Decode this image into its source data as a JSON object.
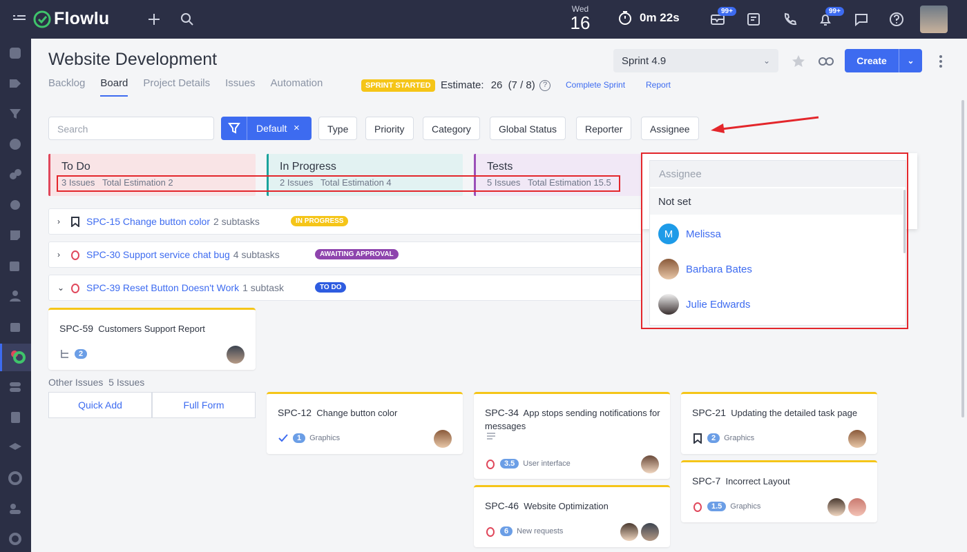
{
  "app": {
    "name": "Flowlu"
  },
  "topbar": {
    "date_weekday": "Wed",
    "date_day": "16",
    "timer": "0m 22s",
    "mail_badge": "99+",
    "notif_badge": "99+"
  },
  "project": {
    "title": "Website Development",
    "tabs": [
      {
        "label": "Backlog"
      },
      {
        "label": "Board",
        "active": true
      },
      {
        "label": "Project Details"
      },
      {
        "label": "Issues"
      },
      {
        "label": "Automation"
      }
    ],
    "sprint_status": "SPRINT STARTED",
    "estimate_label": "Estimate:",
    "estimate_value": "26",
    "estimate_ratio": "(7 / 8)",
    "help": "?",
    "complete_sprint": "Complete Sprint",
    "report": "Report",
    "sprint_select": "Sprint 4.9",
    "create_label": "Create"
  },
  "filters": {
    "search_placeholder": "Search",
    "default_label": "Default",
    "buttons": [
      "Type",
      "Priority",
      "Category",
      "Global Status",
      "Reporter",
      "Assignee"
    ]
  },
  "columns": [
    {
      "title": "To Do",
      "issues": "3 Issues",
      "estimation": "Total Estimation 2",
      "color": "#f9e4e6",
      "accent": "#e0475b"
    },
    {
      "title": "In Progress",
      "issues": "2 Issues",
      "estimation": "Total Estimation 4",
      "color": "#e2f2f2",
      "accent": "#1aa39c"
    },
    {
      "title": "Tests",
      "issues": "5 Issues",
      "estimation": "Total Estimation 15.5",
      "color": "#f1e8f6",
      "accent": "#9b4fb8"
    }
  ],
  "issues": [
    {
      "key": "SPC-15 Change button color",
      "subtasks": "2 subtasks",
      "status": "IN PROGRESS",
      "status_color": "#f5c518"
    },
    {
      "key": "SPC-30 Support service chat bug",
      "subtasks": "4 subtasks",
      "status": "AWAITING APPROVAL",
      "status_color": "#8e44ad"
    },
    {
      "key": "SPC-39 Reset Button Doesn't Work",
      "subtasks": "1 subtask",
      "status": "TO DO",
      "status_color": "#2e5ce0"
    }
  ],
  "cards": {
    "spc59": {
      "key": "SPC-59",
      "title": "Customers Support Report",
      "count": "2"
    },
    "spc12": {
      "key": "SPC-12",
      "title": "Change button color",
      "count": "1",
      "category": "Graphics"
    },
    "spc34": {
      "key": "SPC-34",
      "title": "App stops sending notifications for messages",
      "count": "3.5",
      "category": "User interface"
    },
    "spc46": {
      "key": "SPC-46",
      "title": "Website Optimization",
      "count": "6",
      "category": "New requests"
    },
    "spc21": {
      "key": "SPC-21",
      "title": "Updating the detailed task page",
      "count": "2",
      "category": "Graphics"
    },
    "spc7": {
      "key": "SPC-7",
      "title": "Incorrect Layout",
      "count": "1.5",
      "category": "Graphics"
    }
  },
  "other_issues": {
    "label": "Other Issues",
    "count": "5 Issues",
    "quick_add": "Quick Add",
    "full_form": "Full Form"
  },
  "assignee_dropdown": {
    "placeholder": "Assignee",
    "not_set": "Not set",
    "users": [
      {
        "name": "Melissa",
        "initial": "M"
      },
      {
        "name": "Barbara Bates"
      },
      {
        "name": "Julie Edwards"
      }
    ]
  },
  "colors": {
    "accent": "#3d6bf0",
    "topbar": "#2b2f45",
    "annotation": "#e3262b"
  }
}
